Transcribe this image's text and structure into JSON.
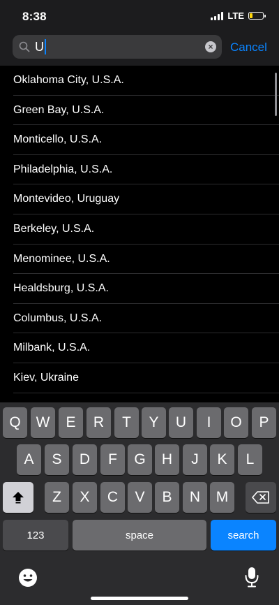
{
  "status": {
    "time": "8:38",
    "network": "LTE"
  },
  "search": {
    "query": "U",
    "cancel_label": "Cancel"
  },
  "results": [
    "Oklahoma City, U.S.A.",
    "Green Bay, U.S.A.",
    "Monticello, U.S.A.",
    "Philadelphia, U.S.A.",
    "Montevideo, Uruguay",
    "Berkeley, U.S.A.",
    "Menominee, U.S.A.",
    "Healdsburg, U.S.A.",
    "Columbus, U.S.A.",
    "Milbank, U.S.A.",
    "Kiev, Ukraine"
  ],
  "keyboard": {
    "row1": [
      "Q",
      "W",
      "E",
      "R",
      "T",
      "Y",
      "U",
      "I",
      "O",
      "P"
    ],
    "row2": [
      "A",
      "S",
      "D",
      "F",
      "G",
      "H",
      "J",
      "K",
      "L"
    ],
    "row3": [
      "Z",
      "X",
      "C",
      "V",
      "B",
      "N",
      "M"
    ],
    "numbers_label": "123",
    "space_label": "space",
    "search_label": "search"
  },
  "colors": {
    "accent": "#0a84ff",
    "background": "#000000",
    "keyboard_bg": "#2c2c2e"
  }
}
